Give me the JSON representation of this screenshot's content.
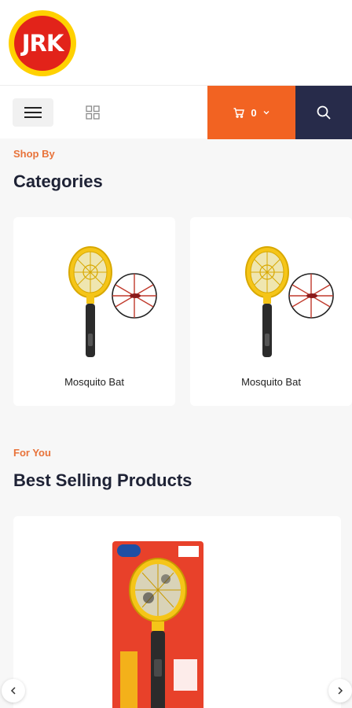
{
  "brand": {
    "logo_text": "JRK",
    "colors": {
      "red": "#e2231a",
      "yellow": "#ffd100"
    }
  },
  "nav": {
    "menu_icon": "hamburger-icon",
    "grid_icon": "grid-view-icon",
    "cart_count": "0",
    "cart_icon": "cart-icon",
    "search_icon": "search-icon",
    "colors": {
      "cart_bg": "#f26322",
      "search_bg": "#272b4a"
    }
  },
  "categories_section": {
    "eyebrow": "Shop By",
    "title": "Categories",
    "items": [
      {
        "name": "Mosquito Bat"
      },
      {
        "name": "Mosquito Bat"
      }
    ]
  },
  "products_section": {
    "eyebrow": "For You",
    "title": "Best Selling Products",
    "carousel_prev_icon": "chevron-left-icon",
    "carousel_next_icon": "chevron-right-icon"
  }
}
